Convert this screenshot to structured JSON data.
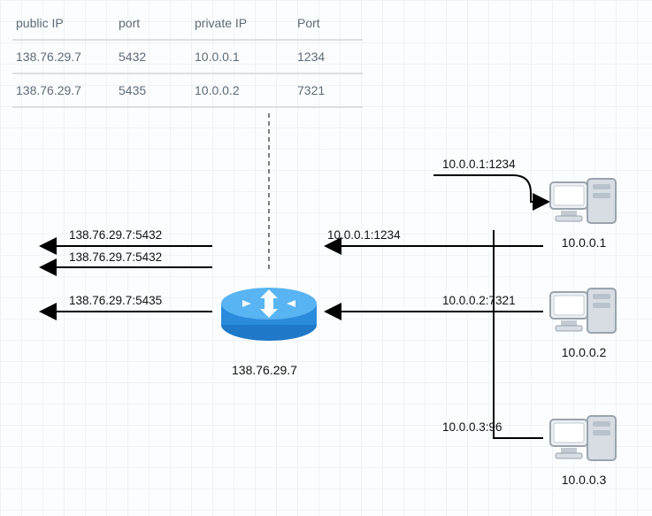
{
  "nat_table": {
    "headers": [
      "public IP",
      "port",
      "private IP",
      "Port"
    ],
    "rows": [
      [
        "138.76.29.7",
        "5432",
        "10.0.0.1",
        "1234"
      ],
      [
        "138.76.29.7",
        "5435",
        "10.0.0.2",
        "7321"
      ]
    ]
  },
  "router": {
    "ip": "138.76.29.7"
  },
  "hosts": [
    {
      "ip": "10.0.0.1"
    },
    {
      "ip": "10.0.0.2"
    },
    {
      "ip": "10.0.0.3"
    }
  ],
  "flow_labels": {
    "top_right_to_host1": "10.0.0.1:1234",
    "to_router_from_host1": "10.0.0.1:1234",
    "router_out_5432_top": "138.76.29.7:5432",
    "router_out_5432_bottom": "138.76.29.7:5432",
    "router_out_5435": "138.76.29.7:5435",
    "from_host2": "10.0.0.2:7321",
    "from_host3": "10.0.0.3:96"
  }
}
